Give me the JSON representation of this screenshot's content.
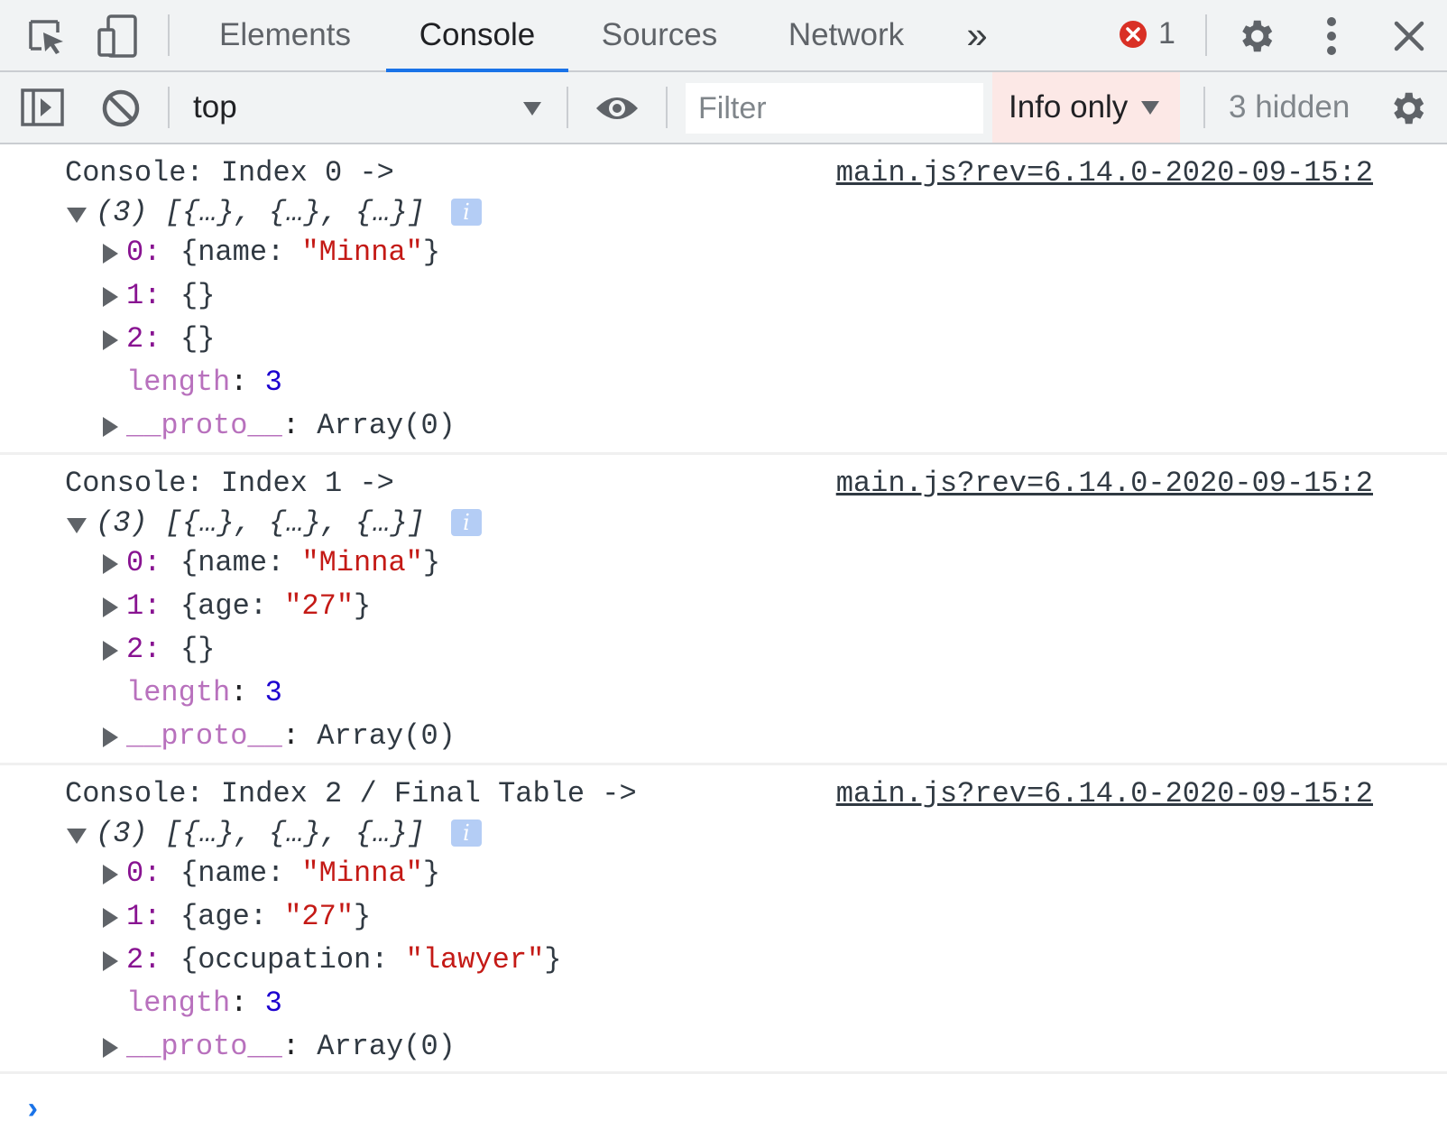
{
  "tabs": [
    {
      "label": "Elements"
    },
    {
      "label": "Console"
    },
    {
      "label": "Sources"
    },
    {
      "label": "Network"
    }
  ],
  "tab_overflow": "»",
  "error_count": "1",
  "toolbar": {
    "context": "top",
    "filter_placeholder": "Filter",
    "levels": "Info only",
    "hidden": "3 hidden"
  },
  "messages": [
    {
      "text": "Console: Index 0 ->",
      "source": "main.js?rev=6.14.0-2020-09-15:2",
      "summary": "(3) [{…}, {…}, {…}]",
      "items": [
        {
          "key": "0",
          "value": "{name: \"Minna\"}"
        },
        {
          "key": "1",
          "value": "{}"
        },
        {
          "key": "2",
          "value": "{}"
        }
      ],
      "length_key": "length",
      "length_value": "3",
      "proto_key": "__proto__",
      "proto_value": "Array(0)"
    },
    {
      "text": "Console: Index 1 ->",
      "source": "main.js?rev=6.14.0-2020-09-15:2",
      "summary": "(3) [{…}, {…}, {…}]",
      "items": [
        {
          "key": "0",
          "value": "{name: \"Minna\"}"
        },
        {
          "key": "1",
          "value": "{age: \"27\"}"
        },
        {
          "key": "2",
          "value": "{}"
        }
      ],
      "length_key": "length",
      "length_value": "3",
      "proto_key": "__proto__",
      "proto_value": "Array(0)"
    },
    {
      "text": "Console: Index 2 / Final Table ->",
      "source": "main.js?rev=6.14.0-2020-09-15:2",
      "summary": "(3) [{…}, {…}, {…}]",
      "items": [
        {
          "key": "0",
          "value": "{name: \"Minna\"}"
        },
        {
          "key": "1",
          "value": "{age: \"27\"}"
        },
        {
          "key": "2",
          "value": "{occupation: \"lawyer\"}"
        }
      ],
      "length_key": "length",
      "length_value": "3",
      "proto_key": "__proto__",
      "proto_value": "Array(0)"
    }
  ],
  "icons": {
    "inspect": "inspect-element-icon",
    "device": "device-toolbar-icon",
    "error": "error-icon",
    "settings": "gear-icon",
    "more": "kebab-menu-icon",
    "close": "close-icon",
    "sidebar": "sidebar-toggle-icon",
    "clear": "clear-console-icon",
    "eye": "live-expression-icon"
  },
  "colors": {
    "accent": "#1a73e8",
    "error": "#d93025",
    "levels_bg": "#fce8e6",
    "string": "#c41a16",
    "number": "#1c00cf",
    "key": "#881391"
  }
}
